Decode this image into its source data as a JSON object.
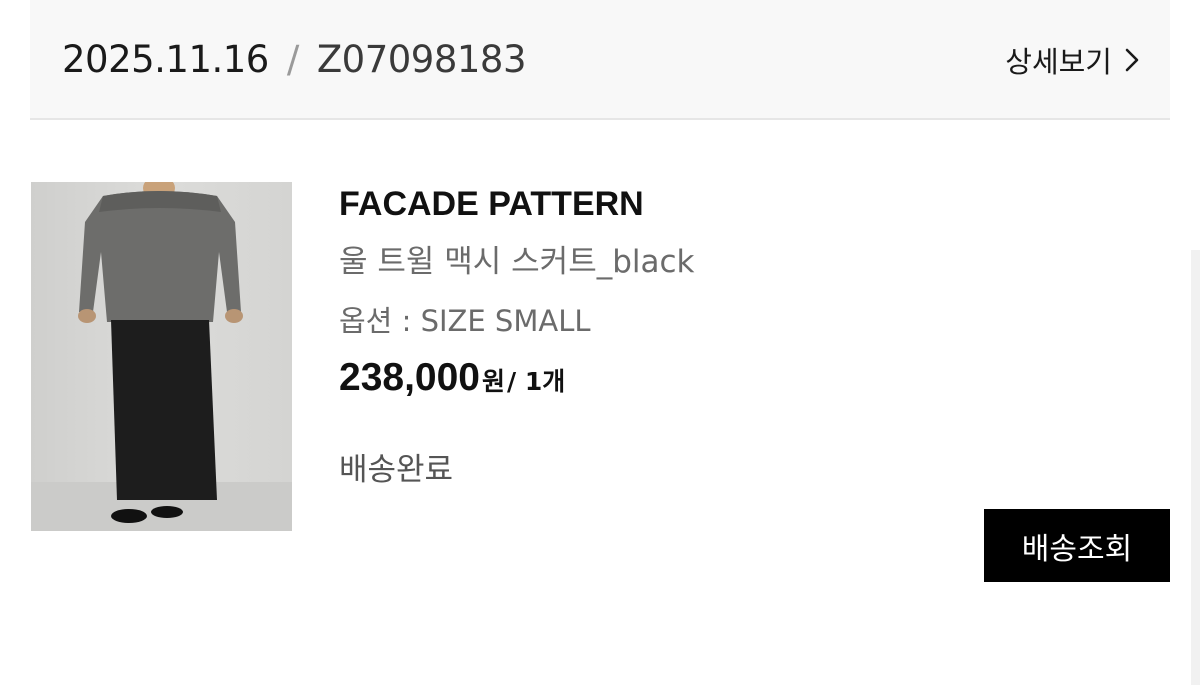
{
  "order": {
    "date": "2025.11.16",
    "separator": "/",
    "number": "Z07098183",
    "detail_link_label": "상세보기"
  },
  "product": {
    "brand": "FACADE PATTERN",
    "name": "울 트윌 맥시 스커트_black",
    "option": "옵션 : SIZE SMALL",
    "price": "238,000",
    "price_unit": "원",
    "quantity": "/ 1개",
    "status": "배송완료",
    "image_alt": "model wearing grey sweater and black maxi skirt"
  },
  "actions": {
    "track_delivery_label": "배송조회"
  },
  "icons": {
    "detail_chevron": "chevron-right-icon"
  },
  "colors": {
    "header_bg": "#f8f8f8",
    "button_bg": "#000000",
    "muted_text": "#6b6b6b"
  }
}
